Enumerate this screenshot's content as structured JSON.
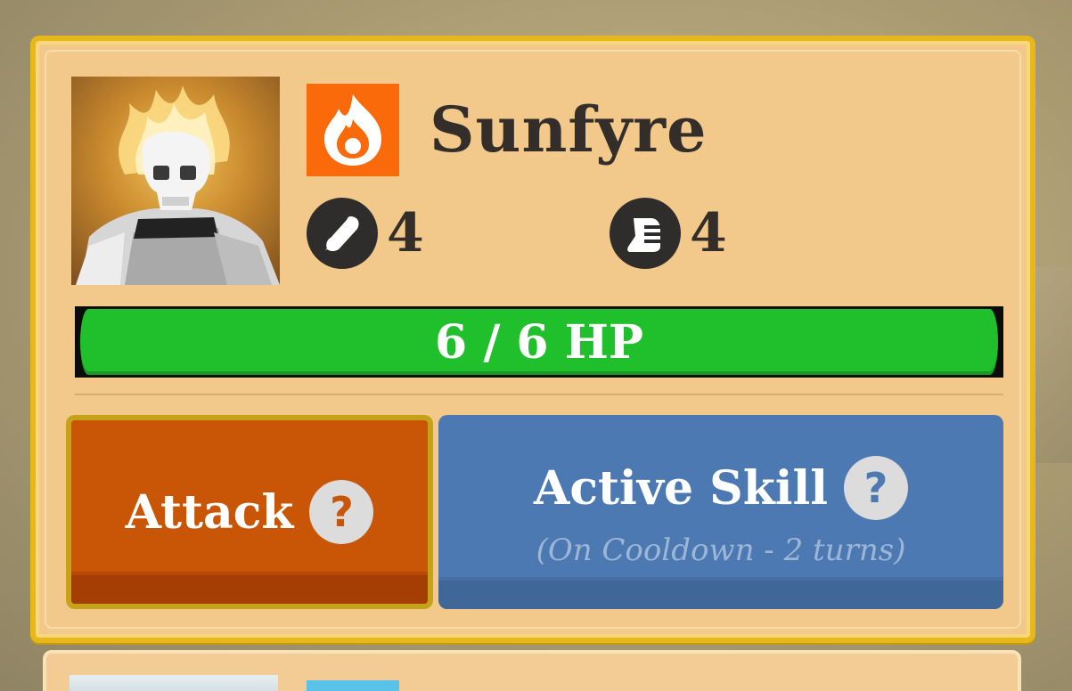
{
  "unit": {
    "name": "Sunfyre",
    "element": "fire-icon",
    "portrait": "skeleton-warrior-portrait",
    "stats": [
      {
        "icon": "attack-icon",
        "value": "4"
      },
      {
        "icon": "speed-icon",
        "value": "4"
      }
    ],
    "hp": {
      "text": "6 / 6 HP",
      "current": 6,
      "max": 6
    }
  },
  "actions": {
    "attack": {
      "label": "Attack",
      "help_icon": "help-icon"
    },
    "skill": {
      "label": "Active Skill",
      "subtitle": "(On Cooldown - 2 turns)",
      "help_icon": "help-icon"
    }
  },
  "colors": {
    "card_bg": "#f2c98a",
    "card_border": "#e7b81a",
    "element_bg": "#fb6a0a",
    "hp_fill": "#20c02c",
    "attack_bg": "#c85606",
    "skill_bg": "#4c79b2"
  }
}
